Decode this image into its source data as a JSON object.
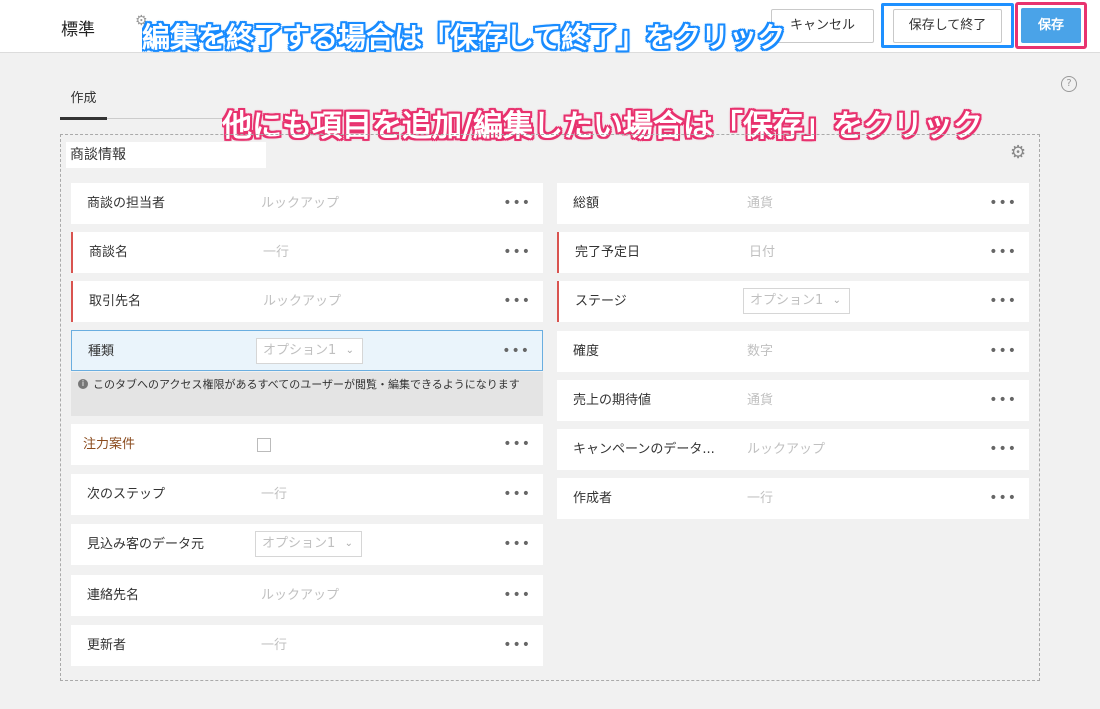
{
  "header": {
    "title": "標準",
    "cancel_label": "キャンセル",
    "save_exit_label": "保存して終了",
    "save_label": "保存"
  },
  "annotations": {
    "top": "編集を終了する場合は「保存して終了」をクリック",
    "middle": "他にも項目を追加/編集したい場合は「保存」をクリック"
  },
  "tabs": [
    {
      "label": "作成"
    }
  ],
  "section": {
    "title": "商談情報",
    "notice": "このタブへのアクセス権限があるすべてのユーザーが閲覧・編集できるようになります",
    "left_fields": [
      {
        "label": "商談の担当者",
        "placeholder": "ルックアップ"
      },
      {
        "label": "商談名",
        "placeholder": "一行"
      },
      {
        "label": "取引先名",
        "placeholder": "ルックアップ"
      },
      {
        "label": "種類",
        "placeholder": "オプション1"
      },
      {
        "label": "注力案件",
        "placeholder": ""
      },
      {
        "label": "次のステップ",
        "placeholder": "一行"
      },
      {
        "label": "見込み客のデータ元",
        "placeholder": "オプション1"
      },
      {
        "label": "連絡先名",
        "placeholder": "ルックアップ"
      },
      {
        "label": "更新者",
        "placeholder": "一行"
      }
    ],
    "right_fields": [
      {
        "label": "総額",
        "placeholder": "通貨"
      },
      {
        "label": "完了予定日",
        "placeholder": "日付"
      },
      {
        "label": "ステージ",
        "placeholder": "オプション1"
      },
      {
        "label": "確度",
        "placeholder": "数字"
      },
      {
        "label": "売上の期待値",
        "placeholder": "通貨"
      },
      {
        "label": "キャンペーンのデータ...",
        "placeholder": "ルックアップ"
      },
      {
        "label": "作成者",
        "placeholder": "一行"
      }
    ],
    "more_glyph": "•••"
  },
  "colors": {
    "accent_blue": "#4aa3e8",
    "highlight_blue": "#1e90ff",
    "highlight_pink": "#e8336f",
    "required_red": "#d9534f"
  }
}
